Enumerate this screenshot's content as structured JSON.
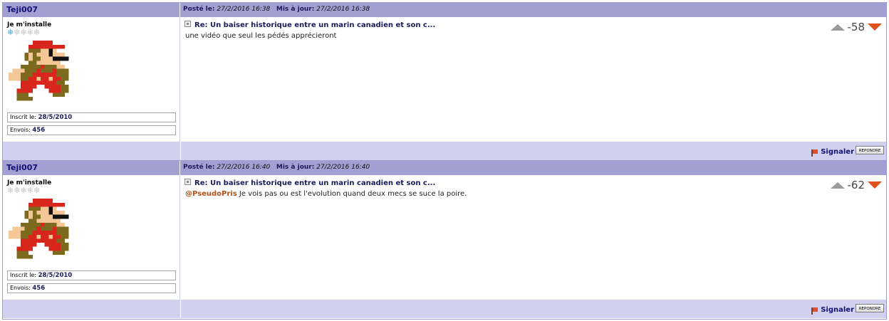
{
  "colors": {
    "header_bg": "#a2a0d2",
    "footer_bg": "#d1d0ee",
    "author": "#121276",
    "mention": "#b0531a",
    "vote_down": "#e0501a",
    "vote_up": "#9b9b9b"
  },
  "labels": {
    "posted": "Posté le:",
    "updated": "Mis à jour:",
    "signaler": "Signaler",
    "repondre": "REPONDRE",
    "registered": "Inscrit le:",
    "posts": "Envois:"
  },
  "posts": [
    {
      "author": "Teji007",
      "rank": "Je m'installe",
      "stars_filled": 1,
      "stars_total": 5,
      "posted_date": "27/2/2016 16:38",
      "updated_date": "27/2/2016 16:38",
      "registered": "28/5/2010",
      "post_count": "456",
      "subject": "Re: Un baiser historique entre un marin canadien et son c...",
      "mention": "",
      "message": "une vidéo que seul les pédés apprécieront",
      "score": "-58"
    },
    {
      "author": "Teji007",
      "rank": "Je m'installe",
      "stars_filled": 1,
      "stars_total": 5,
      "posted_date": "27/2/2016 16:40",
      "updated_date": "27/2/2016 16:40",
      "registered": "28/5/2010",
      "post_count": "456",
      "subject": "Re: Un baiser historique entre un marin canadien et son c...",
      "mention": "@PseudoPris",
      "message": " Je vois pas ou est l'evolution quand deux mecs se suce la poire.",
      "score": "-62"
    }
  ]
}
